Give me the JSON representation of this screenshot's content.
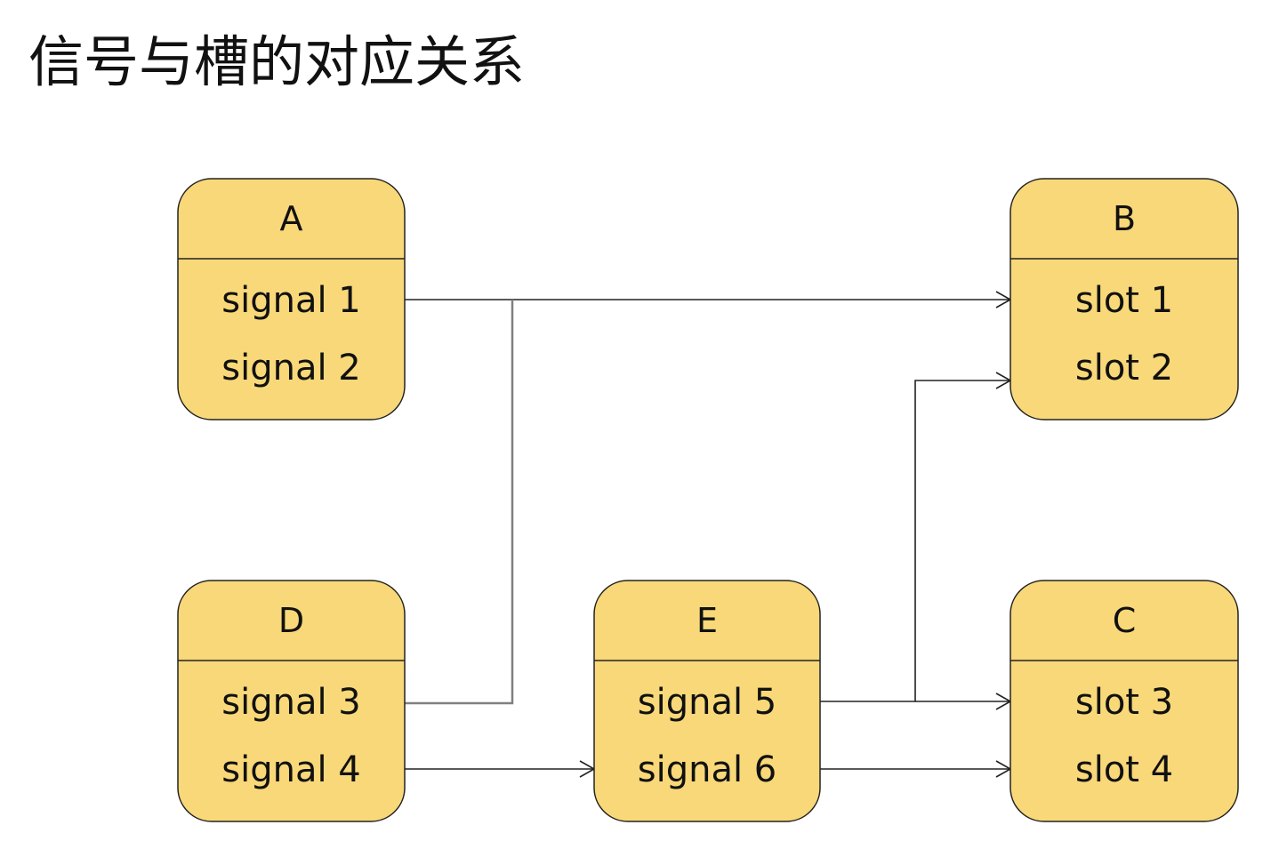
{
  "title": "信号与槽的对应关系",
  "colors": {
    "node_fill": "#f8d878",
    "node_stroke": "#222222",
    "edge": "#222222",
    "edge_gray": "#808080",
    "text": "#111111"
  },
  "nodes": [
    {
      "id": "A",
      "name": "A",
      "ports": [
        {
          "id": "signal1",
          "label": "signal 1"
        },
        {
          "id": "signal2",
          "label": "signal 2"
        }
      ]
    },
    {
      "id": "B",
      "name": "B",
      "ports": [
        {
          "id": "slot1",
          "label": "slot 1"
        },
        {
          "id": "slot2",
          "label": "slot 2"
        }
      ]
    },
    {
      "id": "C",
      "name": "C",
      "ports": [
        {
          "id": "slot3",
          "label": "slot 3"
        },
        {
          "id": "slot4",
          "label": "slot 4"
        }
      ]
    },
    {
      "id": "D",
      "name": "D",
      "ports": [
        {
          "id": "signal3",
          "label": "signal 3"
        },
        {
          "id": "signal4",
          "label": "signal 4"
        }
      ]
    },
    {
      "id": "E",
      "name": "E",
      "ports": [
        {
          "id": "signal5",
          "label": "signal 5"
        },
        {
          "id": "signal6",
          "label": "signal 6"
        }
      ]
    }
  ],
  "edges": [
    {
      "from": "A.signal1",
      "to": "B.slot1"
    },
    {
      "from": "D.signal3",
      "to": "B.slot1"
    },
    {
      "from": "D.signal4",
      "to": "E"
    },
    {
      "from": "E.signal5",
      "to": "B.slot2"
    },
    {
      "from": "E.signal5",
      "to": "C.slot3"
    },
    {
      "from": "E.signal6",
      "to": "C.slot4"
    }
  ]
}
